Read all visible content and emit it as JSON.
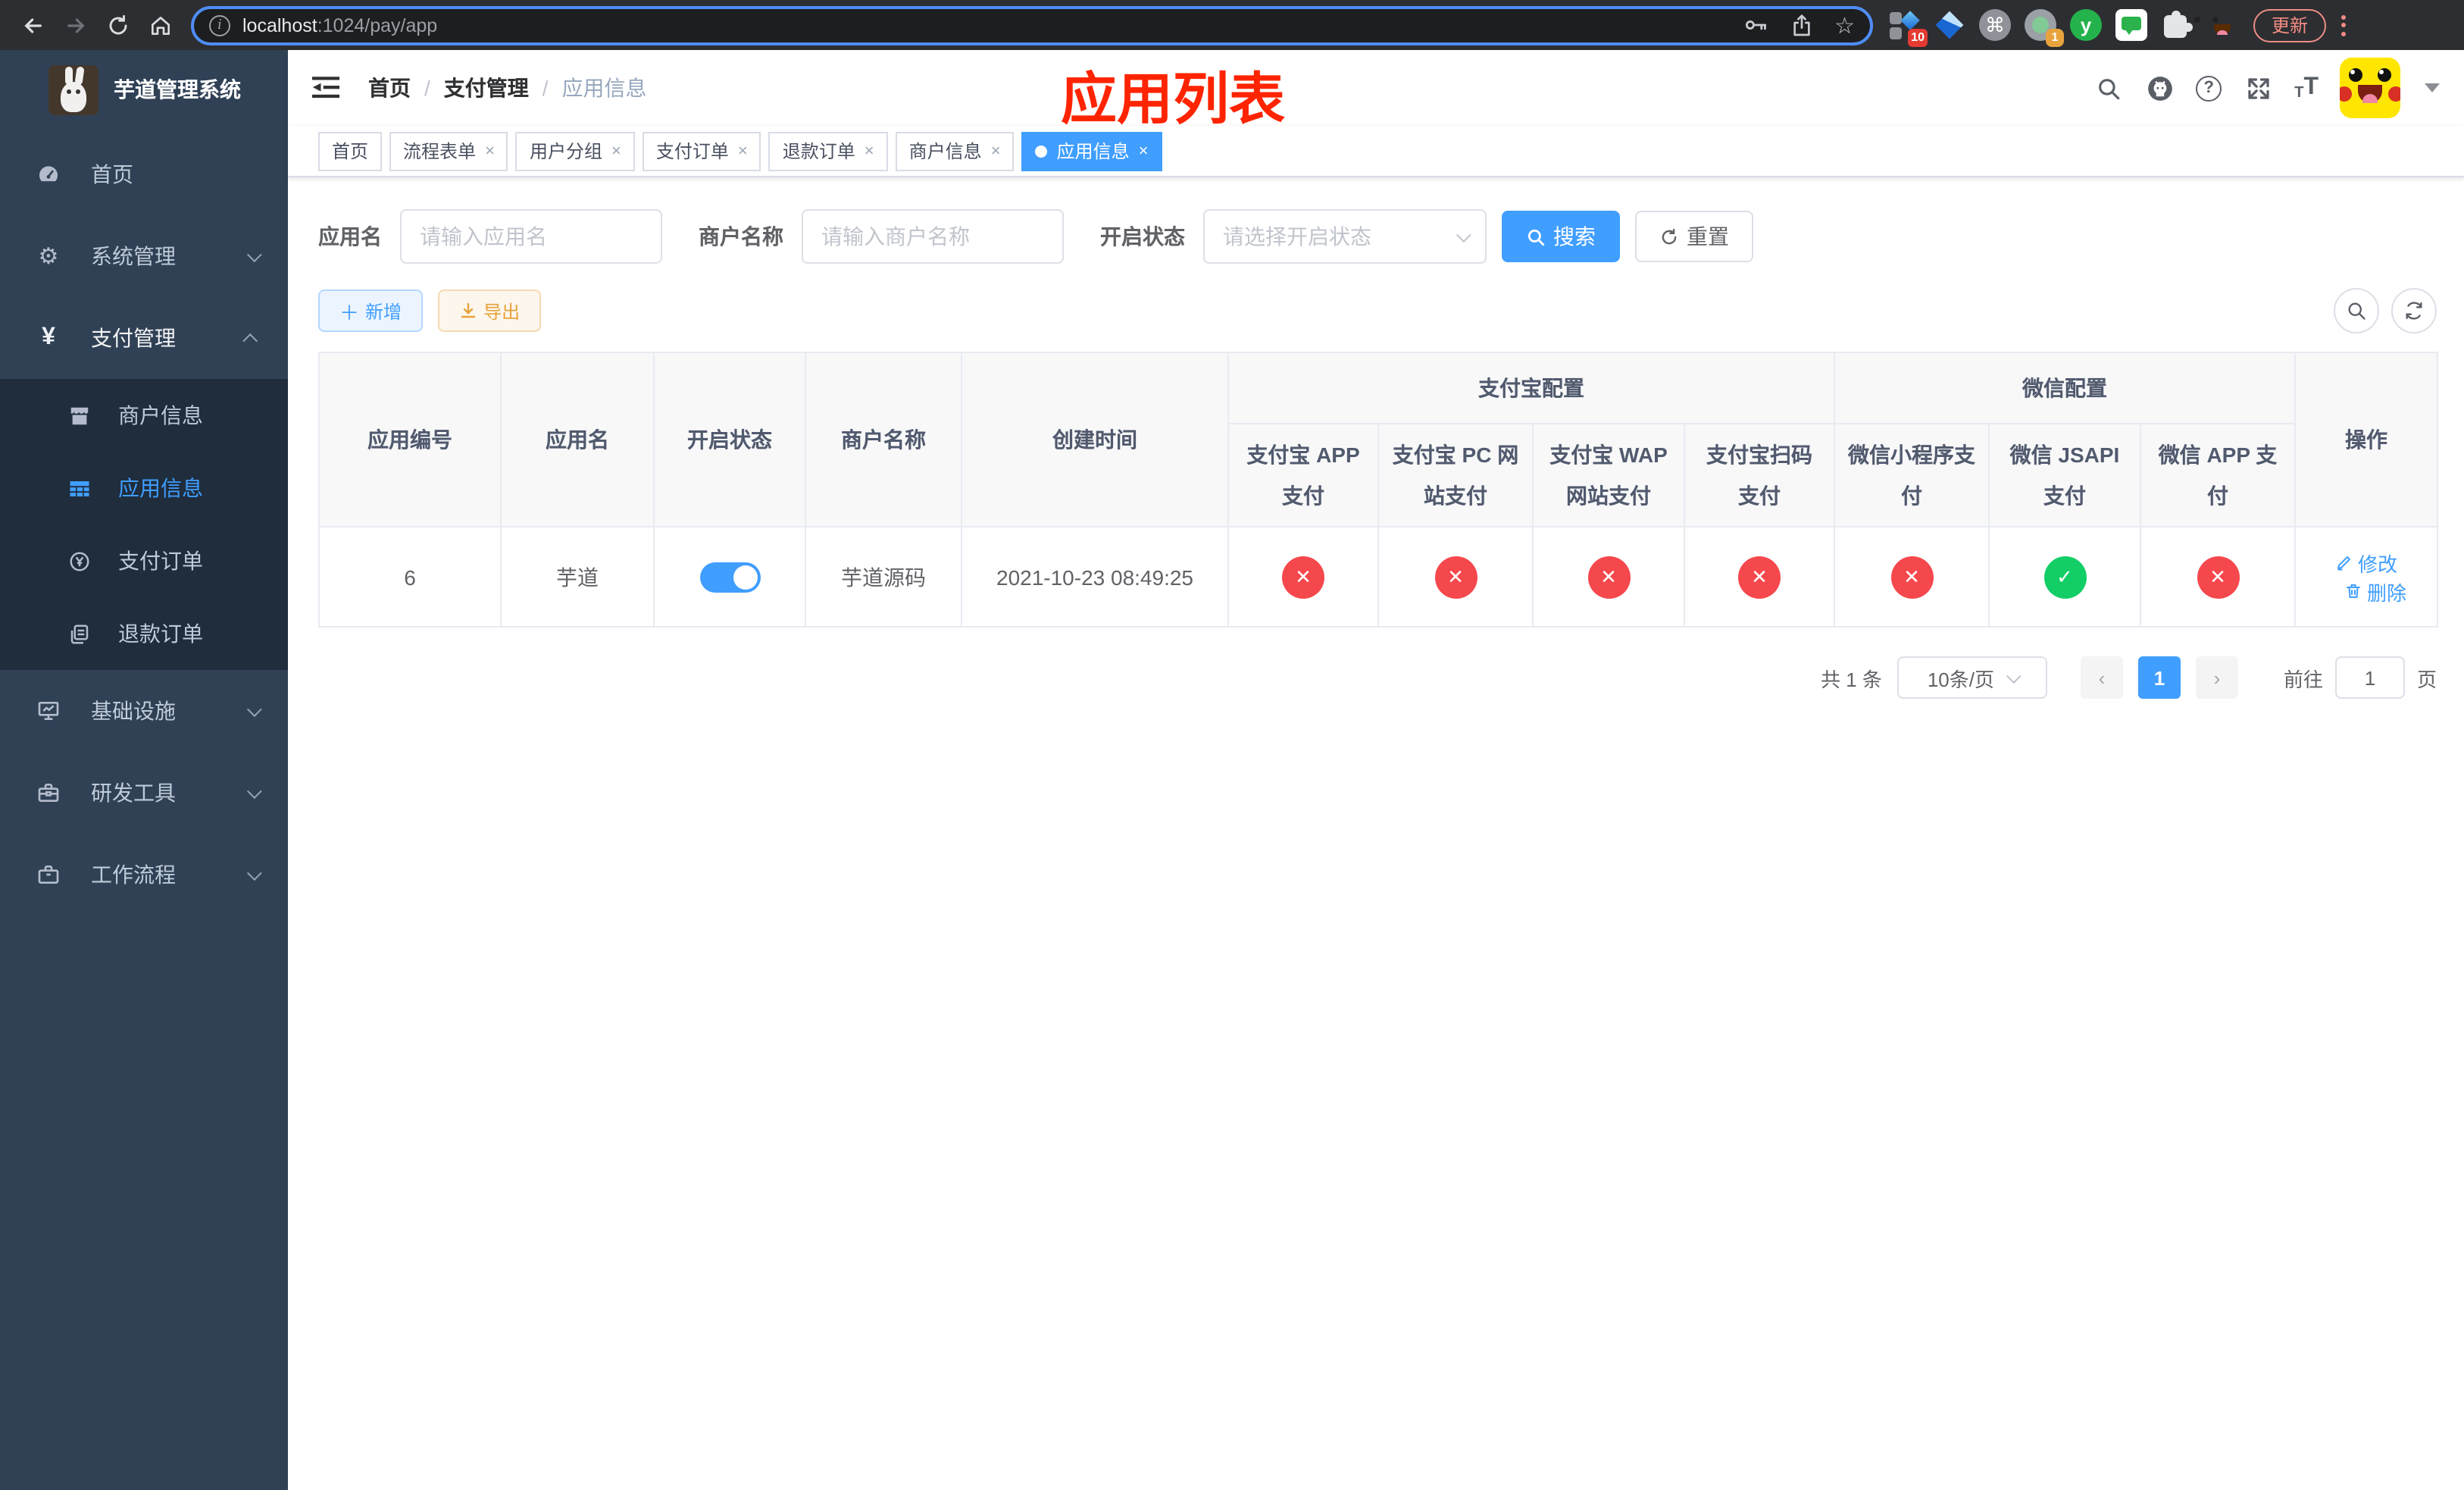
{
  "colors": {
    "accent": "#409eff",
    "danger": "#f5484d",
    "success": "#13ce66",
    "warning": "#e6a23c",
    "sidebar_bg": "#304156",
    "submenu_bg": "#1f2d3d",
    "annotation_red": "#ff2400"
  },
  "browser": {
    "url_host": "localhost",
    "url_path": ":1024/pay/app",
    "update_label": "更新",
    "ext_badge_1": "10",
    "ext_badge_2": "1",
    "ext_letter": "y"
  },
  "sidebar": {
    "title": "芋道管理系统",
    "menu": [
      {
        "label": "首页",
        "icon": "dashboard-icon",
        "expandable": false
      },
      {
        "label": "系统管理",
        "icon": "gear-icon",
        "expandable": true,
        "state": "collapsed"
      },
      {
        "label": "支付管理",
        "icon": "yen-icon",
        "expandable": true,
        "state": "expanded",
        "children": [
          {
            "label": "商户信息",
            "icon": "shop-icon",
            "active": false
          },
          {
            "label": "应用信息",
            "icon": "grid-icon",
            "active": true
          },
          {
            "label": "支付订单",
            "icon": "yen-circle-icon",
            "active": false
          },
          {
            "label": "退款订单",
            "icon": "documents-icon",
            "active": false
          }
        ]
      },
      {
        "label": "基础设施",
        "icon": "monitor-icon",
        "expandable": true,
        "state": "collapsed"
      },
      {
        "label": "研发工具",
        "icon": "toolbox-icon",
        "expandable": true,
        "state": "collapsed"
      },
      {
        "label": "工作流程",
        "icon": "briefcase-icon",
        "expandable": true,
        "state": "collapsed"
      }
    ]
  },
  "navbar": {
    "breadcrumb": [
      "首页",
      "支付管理",
      "应用信息"
    ],
    "separator": "/"
  },
  "annotation": "应用列表",
  "tabs": [
    {
      "label": "首页",
      "closable": false,
      "active": false
    },
    {
      "label": "流程表单",
      "closable": true,
      "active": false
    },
    {
      "label": "用户分组",
      "closable": true,
      "active": false
    },
    {
      "label": "支付订单",
      "closable": true,
      "active": false
    },
    {
      "label": "退款订单",
      "closable": true,
      "active": false
    },
    {
      "label": "商户信息",
      "closable": true,
      "active": false
    },
    {
      "label": "应用信息",
      "closable": true,
      "active": true
    }
  ],
  "filters": {
    "app_name_label": "应用名",
    "app_name_placeholder": "请输入应用名",
    "merchant_label": "商户名称",
    "merchant_placeholder": "请输入商户名称",
    "status_label": "开启状态",
    "status_placeholder": "请选择开启状态",
    "search_label": "搜索",
    "reset_label": "重置"
  },
  "toolbar": {
    "add_label": "新增",
    "export_label": "导出"
  },
  "table": {
    "columns": [
      "应用编号",
      "应用名",
      "开启状态",
      "商户名称",
      "创建时间"
    ],
    "groups": [
      {
        "label": "支付宝配置",
        "children": [
          "支付宝 APP 支付",
          "支付宝 PC 网站支付",
          "支付宝 WAP 网站支付",
          "支付宝扫码支付"
        ]
      },
      {
        "label": "微信配置",
        "children": [
          "微信小程序支付",
          "微信 JSAPI 支付",
          "微信 APP 支付"
        ]
      }
    ],
    "op_column": "操作",
    "row": {
      "id": "6",
      "name": "芋道",
      "enabled": true,
      "merchant": "芋道源码",
      "created": "2021-10-23 08:49:25",
      "channels": {
        "alipay_app": false,
        "alipay_pc": false,
        "alipay_wap": false,
        "alipay_qr": false,
        "wx_lite": false,
        "wx_jsapi": true,
        "wx_app": false
      },
      "edit_label": "修改",
      "delete_label": "删除"
    }
  },
  "pagination": {
    "total": "共 1 条",
    "page_size": "10条/页",
    "page": "1",
    "goto_label": "前往",
    "goto_value": "1",
    "page_unit": "页"
  }
}
